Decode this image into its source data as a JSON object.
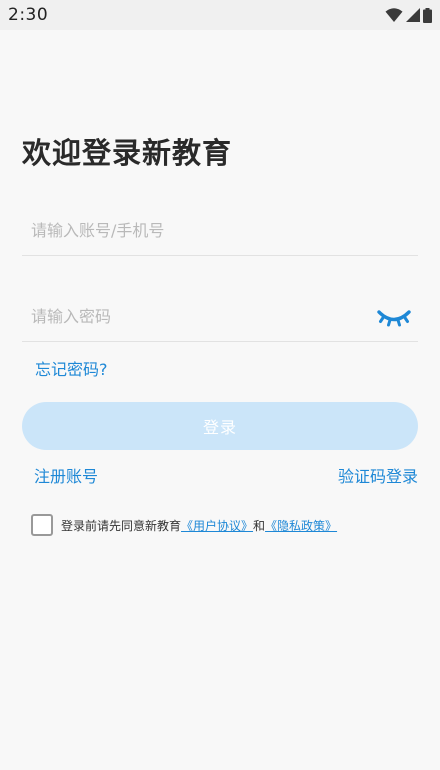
{
  "status_bar": {
    "time": "2:30",
    "icons": [
      "wifi-icon",
      "cellular-signal-icon",
      "battery-icon"
    ]
  },
  "login": {
    "title": "欢迎登录新教育",
    "account_placeholder": "请输入账号/手机号",
    "account_value": "",
    "password_placeholder": "请输入密码",
    "password_value": "",
    "password_toggle_icon": "eye-closed-icon",
    "forgot_password": "忘记密码?",
    "login_button": "登录",
    "register": "注册账号",
    "sms_login": "验证码登录"
  },
  "agreement": {
    "checked": false,
    "prefix": "登录前请先同意新教育",
    "user_agreement": "《用户协议》",
    "conjunction": "和",
    "privacy_policy": "《隐私政策》"
  },
  "colors": {
    "accent": "#1e88d6",
    "button_disabled": "#cbe5f9",
    "background": "#f8f8f8",
    "placeholder": "#b9b9b9"
  }
}
